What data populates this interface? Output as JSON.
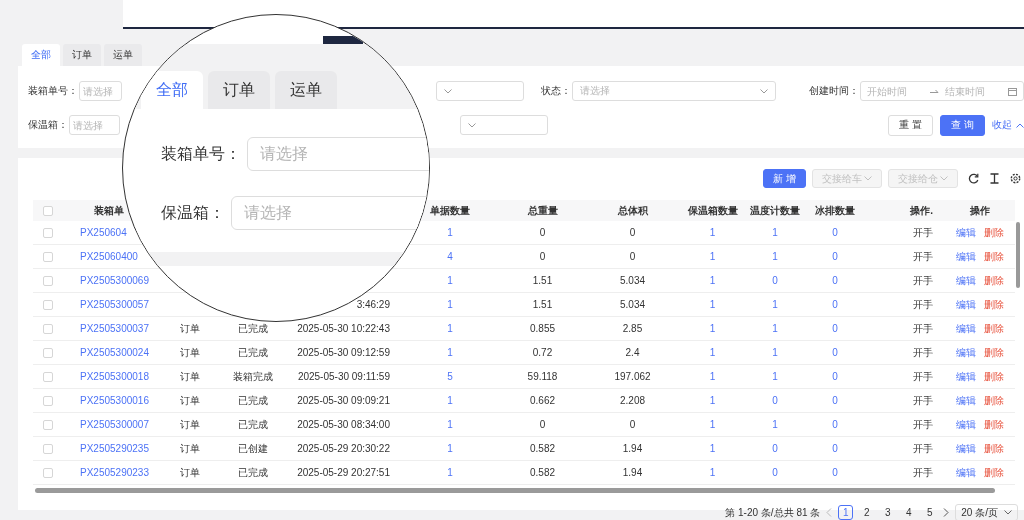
{
  "tabs": [
    {
      "label": "全部",
      "selected": true
    },
    {
      "label": "订单",
      "selected": false
    },
    {
      "label": "运单",
      "selected": false
    }
  ],
  "filter_rows": [
    [
      {
        "kind": "input",
        "label": "装箱单号：",
        "placeholder": "请选择"
      },
      {
        "kind": "select"
      },
      {
        "kind": "select",
        "label": "状态：",
        "placeholder": "请选择"
      },
      {
        "kind": "range",
        "label": "创建时间：",
        "start": {
          "placeholder": "开始时间"
        },
        "end": {
          "placeholder": "结束时间"
        }
      }
    ],
    [
      {
        "kind": "input",
        "label": "保温箱：",
        "placeholder": "请选择"
      },
      {
        "kind": "select"
      },
      {
        "kind": "actions",
        "buttons": [
          {
            "label": "重 置",
            "kind": "default"
          },
          {
            "label": "查 询",
            "kind": "primary"
          },
          {
            "label": "收起",
            "kind": "link"
          }
        ]
      }
    ]
  ],
  "toolbar": [
    {
      "label": "新 增",
      "kind": "primary",
      "disabled": false
    },
    {
      "label": "交接给车",
      "kind": "dropdown",
      "disabled": true
    },
    {
      "label": "交接给仓",
      "kind": "dropdown",
      "disabled": true
    }
  ],
  "table": {
    "all_checked": false,
    "columns": [
      {
        "kind": "link",
        "label": "装箱单"
      },
      {
        "kind": "text"
      },
      {
        "kind": "text"
      },
      {
        "kind": "time"
      },
      {
        "kind": "count",
        "label": "单据数量"
      },
      {
        "kind": "text",
        "label": "总重量"
      },
      {
        "kind": "text",
        "label": "总体积"
      },
      {
        "kind": "count",
        "label": "保温箱数量"
      },
      {
        "kind": "count",
        "label": "温度计数量"
      },
      {
        "kind": "count",
        "label": "冰排数量"
      },
      {
        "kind": "right",
        "label": "操作."
      },
      {
        "kind": "action",
        "label": "操作"
      }
    ],
    "rows": [
      {
        "checked": false,
        "cells": [
          "PX250604",
          null,
          null,
          null,
          "1",
          "0",
          "0",
          "1",
          "1",
          "0",
          "开手"
        ],
        "actions": [
          {
            "label": "编辑",
            "kind": "edit"
          },
          {
            "label": "删除",
            "kind": "delete"
          }
        ]
      },
      {
        "checked": false,
        "cells": [
          "PX25060400",
          null,
          null,
          null,
          "4",
          "0",
          "0",
          "1",
          "1",
          "0",
          "开手"
        ],
        "actions": [
          {
            "label": "编辑",
            "kind": "edit"
          },
          {
            "label": "删除",
            "kind": "delete"
          }
        ]
      },
      {
        "checked": false,
        "cells": [
          "PX2505300069",
          null,
          null,
          null,
          "1",
          "1.51",
          "5.034",
          "1",
          "0",
          "0",
          "开手"
        ],
        "actions": [
          {
            "label": "编辑",
            "kind": "edit"
          },
          {
            "label": "删除",
            "kind": "delete"
          }
        ]
      },
      {
        "checked": false,
        "cells": [
          "PX2505300057",
          null,
          null,
          "3:46:29",
          "1",
          "1.51",
          "5.034",
          "1",
          "1",
          "0",
          "开手"
        ],
        "actions": [
          {
            "label": "编辑",
            "kind": "edit"
          },
          {
            "label": "删除",
            "kind": "delete"
          }
        ]
      },
      {
        "checked": false,
        "cells": [
          "PX2505300037",
          "订单",
          "已完成",
          "2025-05-30 10:22:43",
          "1",
          "0.855",
          "2.85",
          "1",
          "1",
          "0",
          "开手"
        ],
        "actions": [
          {
            "label": "编辑",
            "kind": "edit"
          },
          {
            "label": "删除",
            "kind": "delete"
          }
        ]
      },
      {
        "checked": false,
        "cells": [
          "PX2505300024",
          "订单",
          "已完成",
          "2025-05-30 09:12:59",
          "1",
          "0.72",
          "2.4",
          "1",
          "1",
          "0",
          "开手"
        ],
        "actions": [
          {
            "label": "编辑",
            "kind": "edit"
          },
          {
            "label": "删除",
            "kind": "delete"
          }
        ]
      },
      {
        "checked": false,
        "cells": [
          "PX2505300018",
          "订单",
          "装箱完成",
          "2025-05-30 09:11:59",
          "5",
          "59.118",
          "197.062",
          "1",
          "1",
          "0",
          "开手"
        ],
        "actions": [
          {
            "label": "编辑",
            "kind": "edit"
          },
          {
            "label": "删除",
            "kind": "delete"
          }
        ]
      },
      {
        "checked": false,
        "cells": [
          "PX2505300016",
          "订单",
          "已完成",
          "2025-05-30 09:09:21",
          "1",
          "0.662",
          "2.208",
          "1",
          "0",
          "0",
          "开手"
        ],
        "actions": [
          {
            "label": "编辑",
            "kind": "edit"
          },
          {
            "label": "删除",
            "kind": "delete"
          }
        ]
      },
      {
        "checked": false,
        "cells": [
          "PX2505300007",
          "订单",
          "已完成",
          "2025-05-30 08:34:00",
          "1",
          "0",
          "0",
          "1",
          "1",
          "0",
          "开手"
        ],
        "actions": [
          {
            "label": "编辑",
            "kind": "edit"
          },
          {
            "label": "删除",
            "kind": "delete"
          }
        ]
      },
      {
        "checked": false,
        "cells": [
          "PX2505290235",
          "订单",
          "已创建",
          "2025-05-29 20:30:22",
          "1",
          "0.582",
          "1.94",
          "1",
          "0",
          "0",
          "开手"
        ],
        "actions": [
          {
            "label": "编辑",
            "kind": "edit"
          },
          {
            "label": "删除",
            "kind": "delete"
          }
        ]
      },
      {
        "checked": false,
        "cells": [
          "PX2505290233",
          "订单",
          "已完成",
          "2025-05-29 20:27:51",
          "1",
          "0.582",
          "1.94",
          "1",
          "0",
          "0",
          "开手"
        ],
        "actions": [
          {
            "label": "编辑",
            "kind": "edit"
          },
          {
            "label": "删除",
            "kind": "delete"
          }
        ]
      }
    ]
  },
  "pagination": {
    "summary": "第 1-20 条/总共 81 条",
    "pages": [
      {
        "label": "1",
        "selected": true
      },
      {
        "label": "2",
        "selected": false
      },
      {
        "label": "3",
        "selected": false
      },
      {
        "label": "4",
        "selected": false
      },
      {
        "label": "5",
        "selected": false
      }
    ],
    "page_size": "20 条/页"
  },
  "magnifier": {
    "tabs": [
      {
        "label": "全部",
        "selected": true
      },
      {
        "label": "订单",
        "selected": false
      },
      {
        "label": "运单",
        "selected": false
      }
    ],
    "fields": [
      {
        "label": "装箱单号：",
        "placeholder": "请选择"
      },
      {
        "label": "保温箱：",
        "placeholder": "请选择"
      }
    ]
  }
}
